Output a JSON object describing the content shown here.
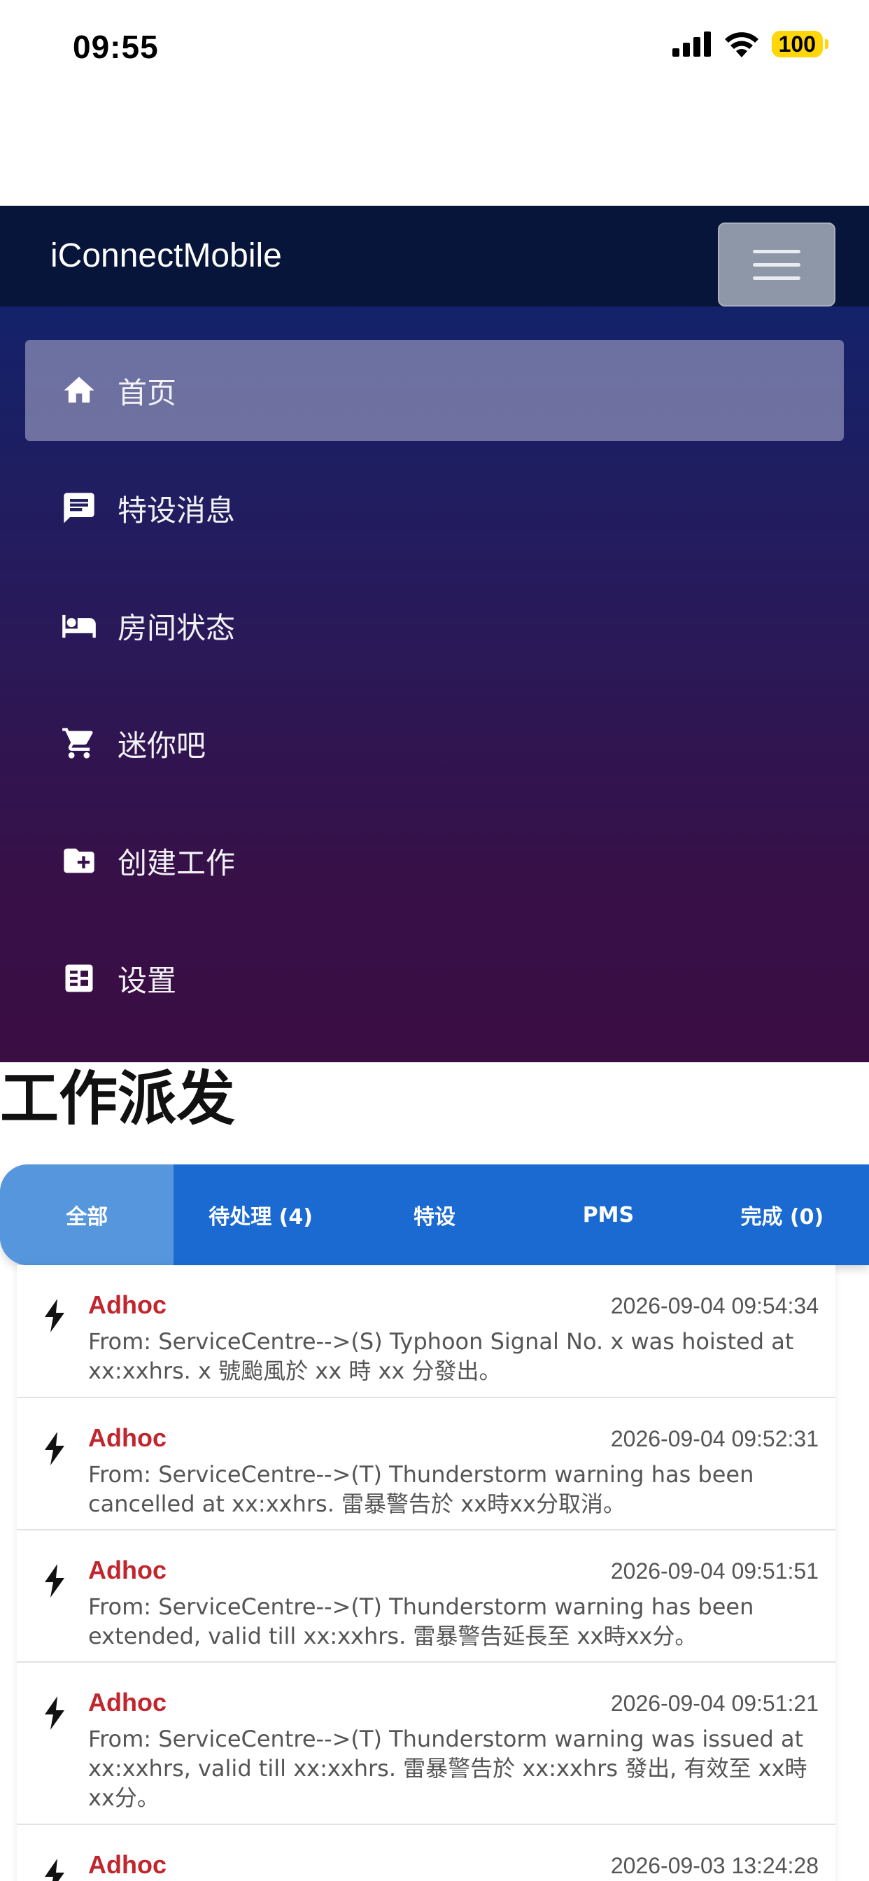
{
  "status_bar": {
    "time": "09:55",
    "battery": "100"
  },
  "navbar": {
    "brand": "iConnectMobile"
  },
  "menu": {
    "items": [
      {
        "label": "首页",
        "icon": "home-icon",
        "active": true
      },
      {
        "label": "特设消息",
        "icon": "message-icon",
        "active": false
      },
      {
        "label": "房间状态",
        "icon": "bed-icon",
        "active": false
      },
      {
        "label": "迷你吧",
        "icon": "cart-icon",
        "active": false
      },
      {
        "label": "创建工作",
        "icon": "folder-add-icon",
        "active": false
      },
      {
        "label": "设置",
        "icon": "settings-list-icon",
        "active": false
      }
    ]
  },
  "page": {
    "title": "工作派发"
  },
  "tabs": [
    {
      "label": "全部",
      "active": true
    },
    {
      "label": "待处理 (4)",
      "active": false
    },
    {
      "label": "特设",
      "active": false
    },
    {
      "label": "PMS",
      "active": false
    },
    {
      "label": "完成 (0)",
      "active": false
    }
  ],
  "jobs": [
    {
      "type": "Adhoc",
      "time": "2026-09-04 09:54:34",
      "text": "From: ServiceCentre-->(S) Typhoon Signal No. x was hoisted at xx:xxhrs. x 號颱風於 xx 時 xx 分發出。"
    },
    {
      "type": "Adhoc",
      "time": "2026-09-04 09:52:31",
      "text": "From: ServiceCentre-->(T) Thunderstorm warning has been cancelled at xx:xxhrs. 雷暴警告於 xx時xx分取消。"
    },
    {
      "type": "Adhoc",
      "time": "2026-09-04 09:51:51",
      "text": "From: ServiceCentre-->(T) Thunderstorm warning has been extended, valid till xx:xxhrs. 雷暴警告延長至 xx時xx分。"
    },
    {
      "type": "Adhoc",
      "time": "2026-09-04 09:51:21",
      "text": "From: ServiceCentre-->(T) Thunderstorm warning was issued at xx:xxhrs, valid till xx:xxhrs. 雷暴警告於 xx:xxhrs 發出, 有效至 xx時xx分。"
    },
    {
      "type": "Adhoc",
      "time": "2026-09-03 13:24:28",
      "text": ""
    }
  ]
}
